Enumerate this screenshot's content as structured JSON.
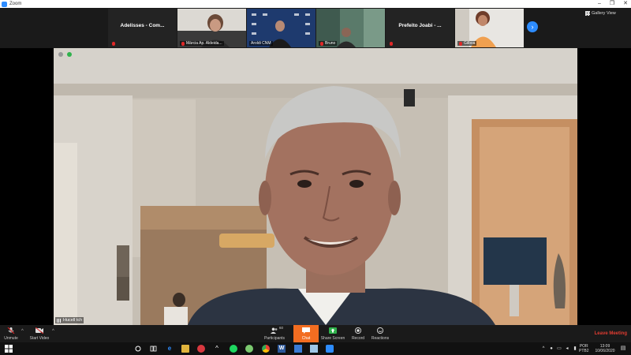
{
  "titlebar": {
    "title": "Zoom",
    "buttons": [
      "–",
      "❐",
      "✕"
    ]
  },
  "strip": {
    "tiles": [
      {
        "name": "Adelisses - Com..."
      },
      {
        "label": "Márcia Ap. Aldeida..."
      },
      {
        "label": "Aroldi CNM"
      },
      {
        "label": "Bruno"
      },
      {
        "name": "Prefeito Joabi - ..."
      },
      {
        "label": "Gilboa"
      }
    ],
    "gallery_view": "Gallery View",
    "next": "›"
  },
  "main": {
    "speaker_label": "Hucell tch"
  },
  "toolbar": {
    "unmute": "Unmute",
    "start_video": "Start Video",
    "participants": "Participants",
    "participants_count": "60",
    "chat": "Chat",
    "share_screen": "Share Screen",
    "record": "Record",
    "reactions": "Reactions",
    "leave": "Leave Meeting"
  },
  "taskbar": {
    "lang": "POR",
    "lang2": "PTB2",
    "time": "13:09",
    "date": "10/06/2020"
  },
  "colors": {
    "zoom_blue": "#2d8cff",
    "chat_orange": "#f26d21",
    "leave_red": "#e03c31",
    "share_green": "#2fb24c"
  }
}
